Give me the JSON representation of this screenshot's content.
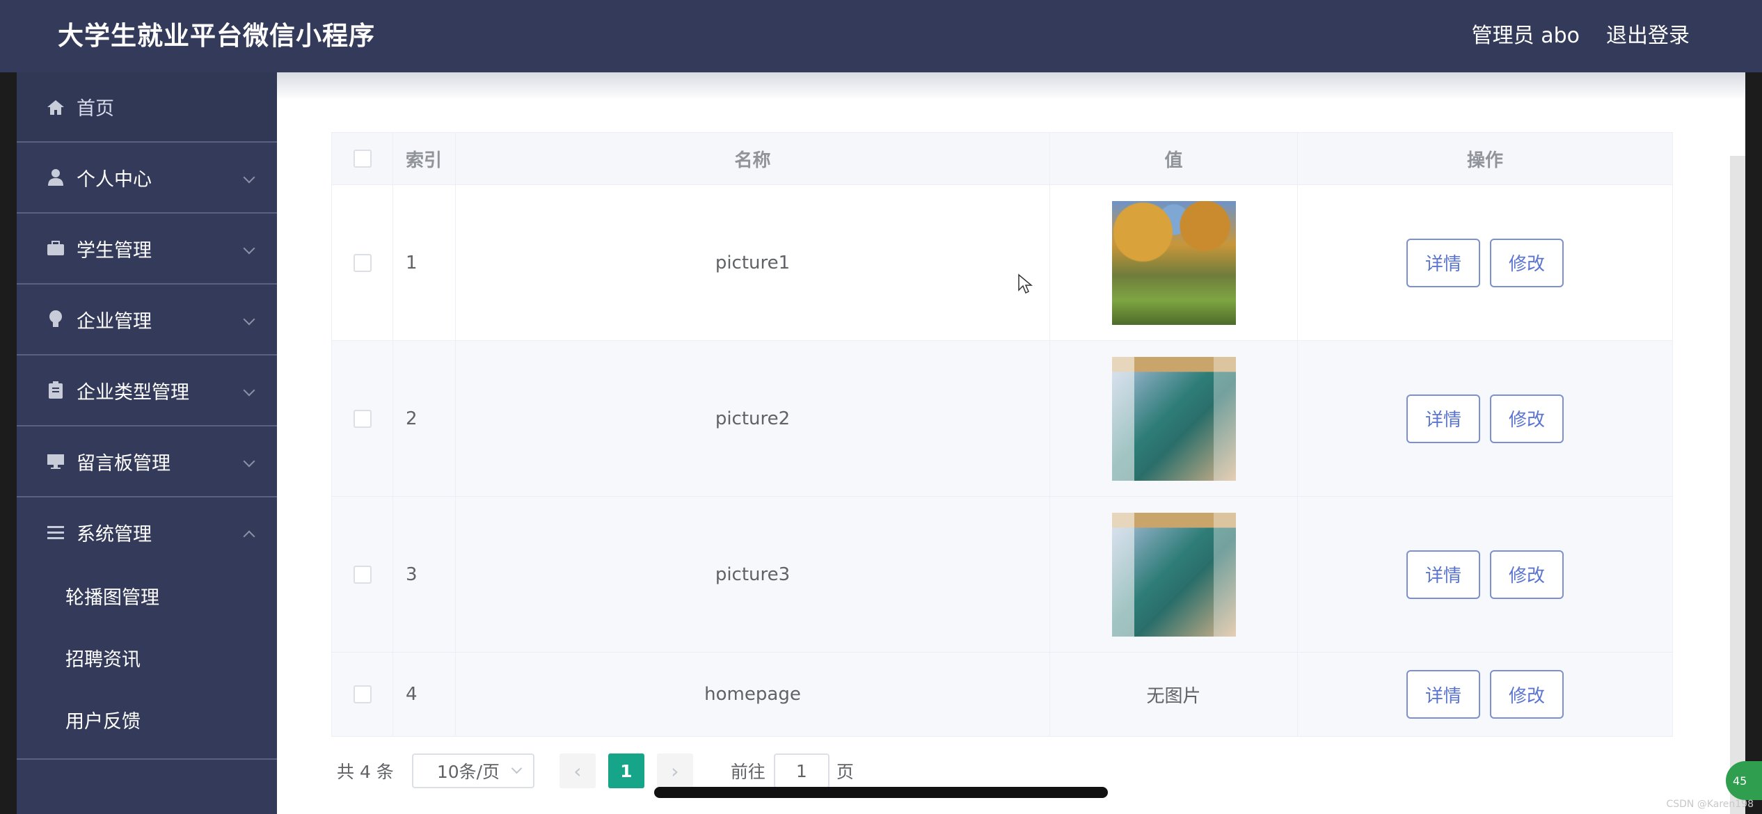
{
  "header": {
    "title": "大学生就业平台微信小程序",
    "user": "管理员 abo",
    "logout": "退出登录"
  },
  "sidebar": {
    "home": "首页",
    "items": [
      {
        "label": "个人中心",
        "icon": "user-icon"
      },
      {
        "label": "学生管理",
        "icon": "briefcase-icon"
      },
      {
        "label": "企业管理",
        "icon": "bulb-icon"
      },
      {
        "label": "企业类型管理",
        "icon": "clipboard-icon"
      },
      {
        "label": "留言板管理",
        "icon": "monitor-icon"
      },
      {
        "label": "系统管理",
        "icon": "menu-lines-icon"
      }
    ],
    "submenu": [
      "轮播图管理",
      "招聘资讯",
      "用户反馈"
    ]
  },
  "table": {
    "headers": {
      "index": "索引",
      "name": "名称",
      "value": "值",
      "actions": "操作"
    },
    "rows": [
      {
        "index": "1",
        "name": "picture1",
        "value": "",
        "image": "park-photo"
      },
      {
        "index": "2",
        "name": "picture2",
        "value": "",
        "image": "classroom-photo"
      },
      {
        "index": "3",
        "name": "picture3",
        "value": "",
        "image": "classroom-photo"
      },
      {
        "index": "4",
        "name": "homepage",
        "value": "无图片",
        "image": ""
      }
    ],
    "detail_label": "详情",
    "edit_label": "修改"
  },
  "pagination": {
    "total": "共 4 条",
    "page_size": "10条/页",
    "current_page": "1",
    "goto_prefix": "前往",
    "goto_value": "1",
    "goto_suffix": "页"
  },
  "watermark": "CSDN @Karen198",
  "badge": "45"
}
